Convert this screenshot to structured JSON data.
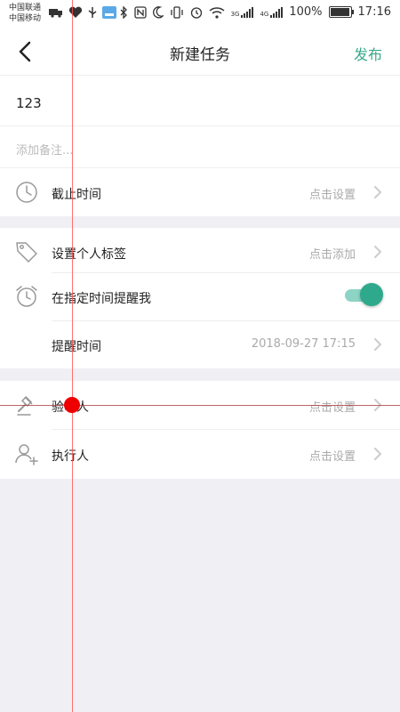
{
  "status_bar": {
    "carrier1": "中国联通",
    "carrier2": "中国移动",
    "net1": "3G",
    "net2": "4G",
    "battery_percent": "100%",
    "time": "17:16"
  },
  "header": {
    "title": "新建任务",
    "publish_label": "发布"
  },
  "task": {
    "title_value": "123",
    "note_placeholder": "添加备注..."
  },
  "deadline": {
    "label": "截止时间",
    "value": "点击设置"
  },
  "tags": {
    "label": "设置个人标签",
    "value": "点击添加"
  },
  "reminder": {
    "label": "在指定时间提醒我",
    "enabled": true
  },
  "remind_time": {
    "label": "提醒时间",
    "value": "2018-09-27  17:15"
  },
  "verifier": {
    "label": "验收人",
    "value": "点击设置"
  },
  "executor": {
    "label": "执行人",
    "value": "点击设置"
  },
  "colors": {
    "accent": "#2ea98c",
    "background": "#efeff4"
  }
}
